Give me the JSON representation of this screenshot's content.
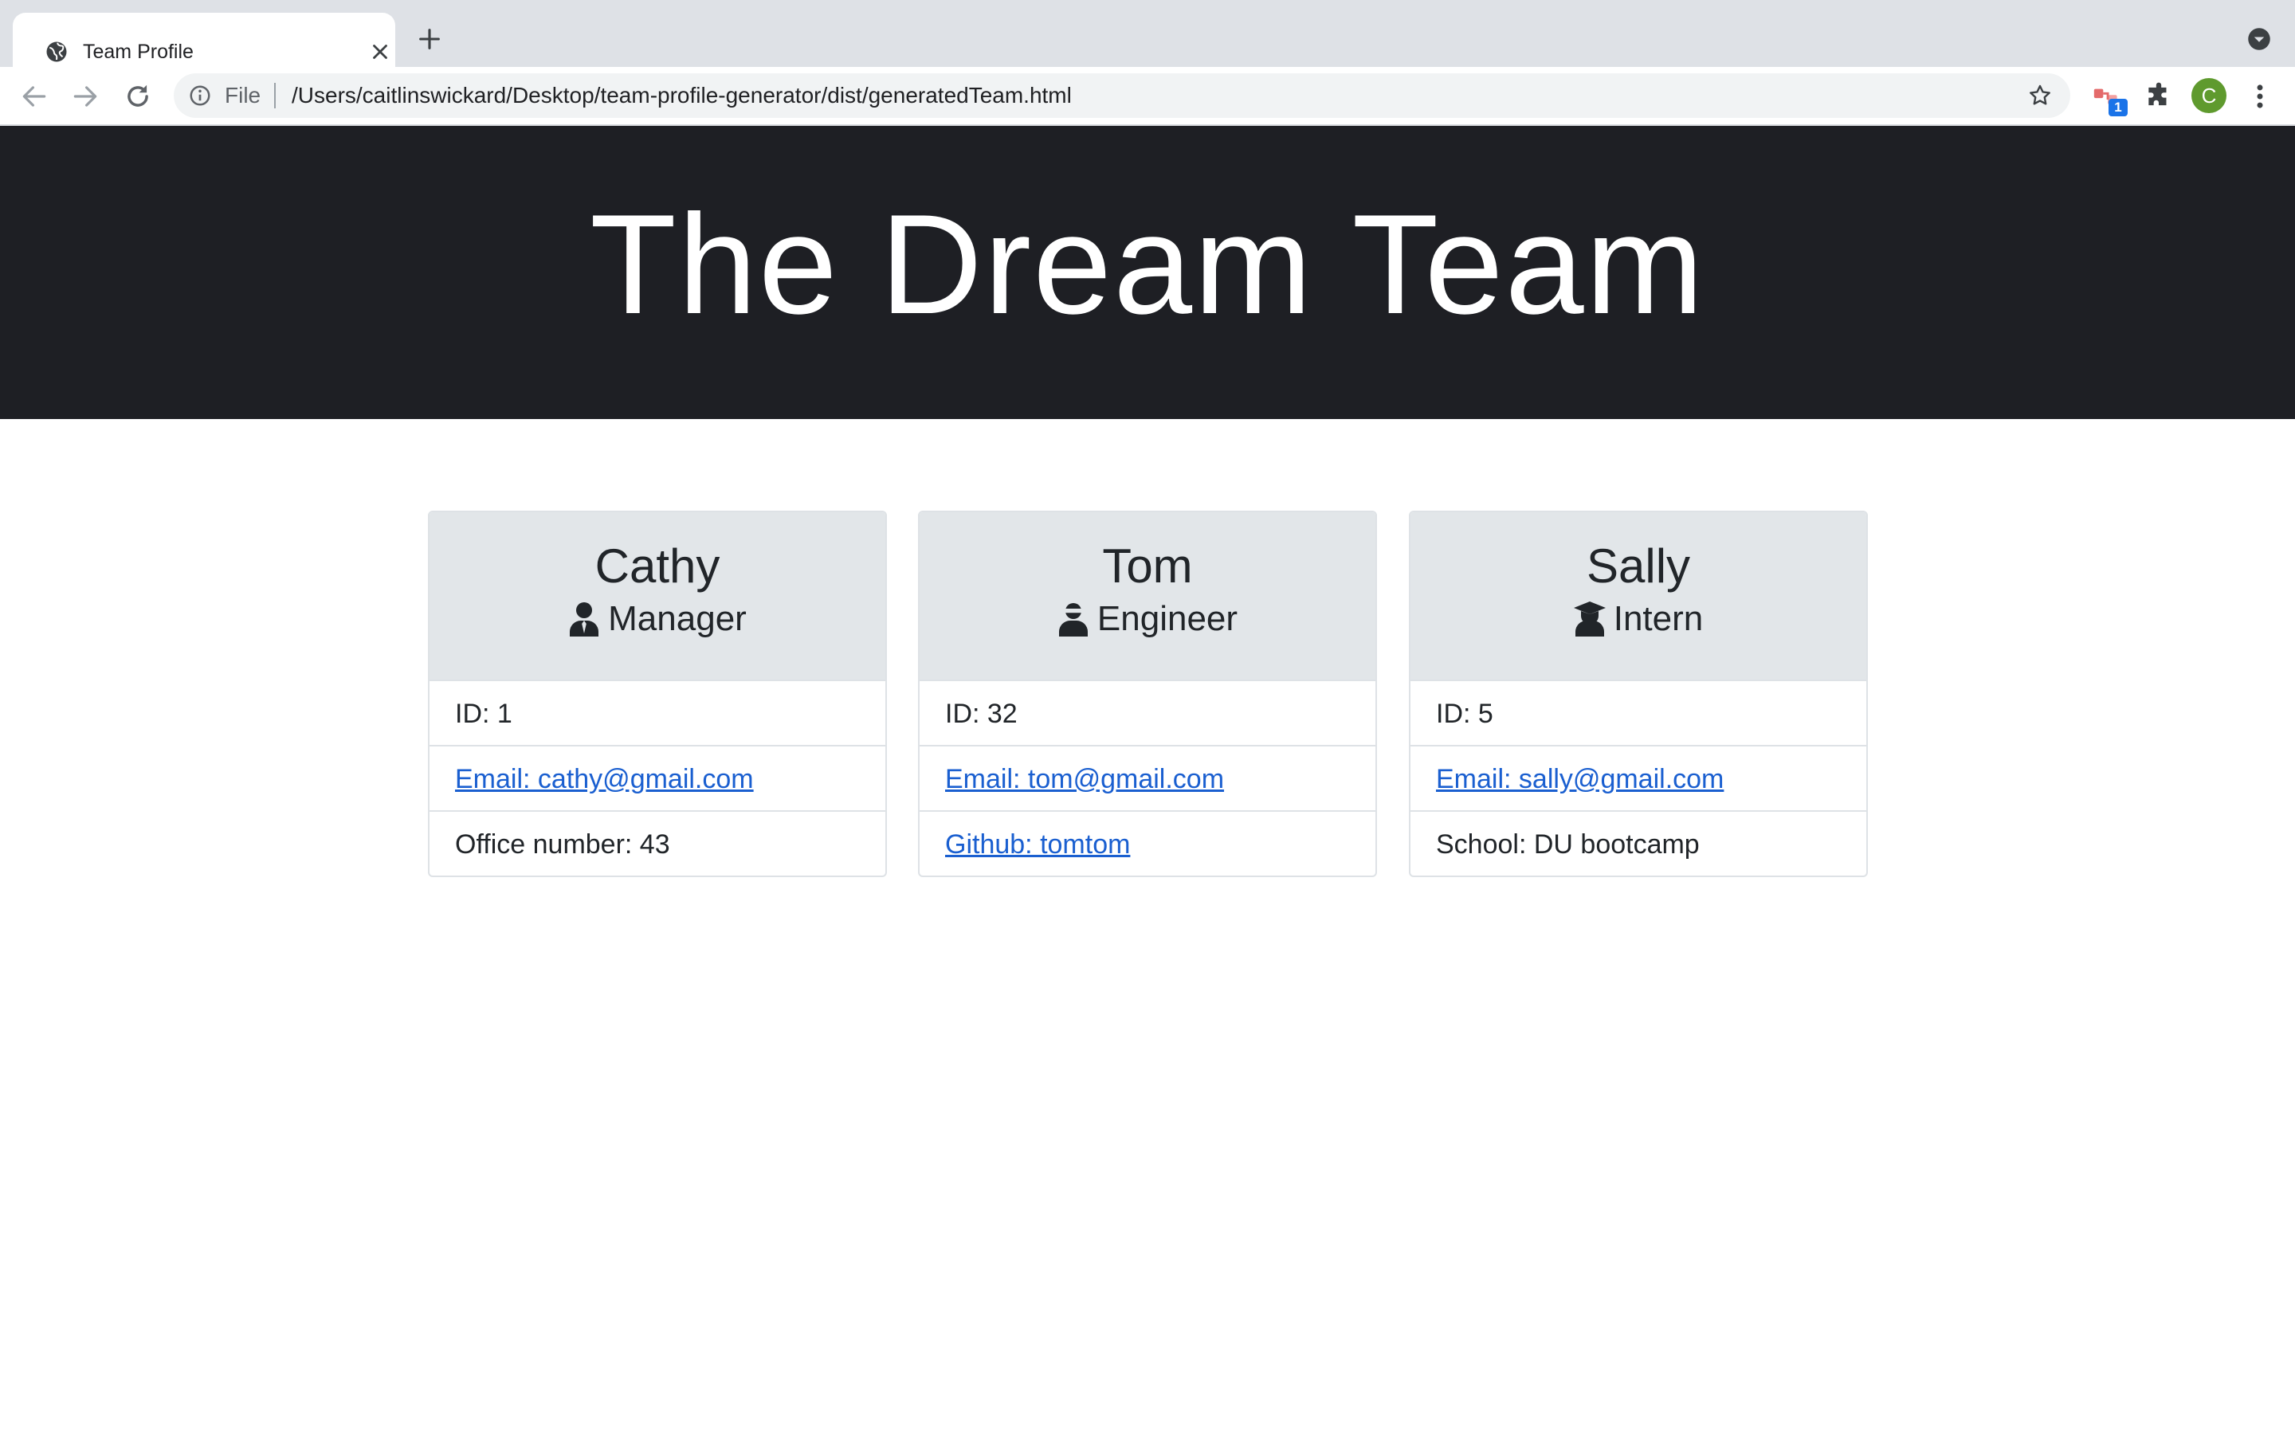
{
  "browser": {
    "tab_title": "Team Profile",
    "omnibox_scheme": "File",
    "url": "/Users/caitlinswickard/Desktop/team-profile-generator/dist/generatedTeam.html",
    "extension_badge": "1",
    "profile_initial": "C"
  },
  "page": {
    "title": "The Dream Team"
  },
  "cards": [
    {
      "name": "Cathy",
      "role": "Manager",
      "role_icon": "manager-icon",
      "id": "ID: 1",
      "email": "Email: cathy@gmail.com",
      "extra": "Office number: 43"
    },
    {
      "name": "Tom",
      "role": "Engineer",
      "role_icon": "engineer-icon",
      "id": "ID: 32",
      "email": "Email: tom@gmail.com",
      "extra": "Github: tomtom"
    },
    {
      "name": "Sally",
      "role": "Intern",
      "role_icon": "graduate-icon",
      "id": "ID: 5",
      "email": "Email: sally@gmail.com",
      "extra": "School: DU bootcamp"
    }
  ],
  "colors": {
    "hero_bg": "#1e1f24",
    "card_header_bg": "#e2e6e9",
    "link": "#1a5fd0",
    "profile_avatar": "#5f9a2e"
  }
}
